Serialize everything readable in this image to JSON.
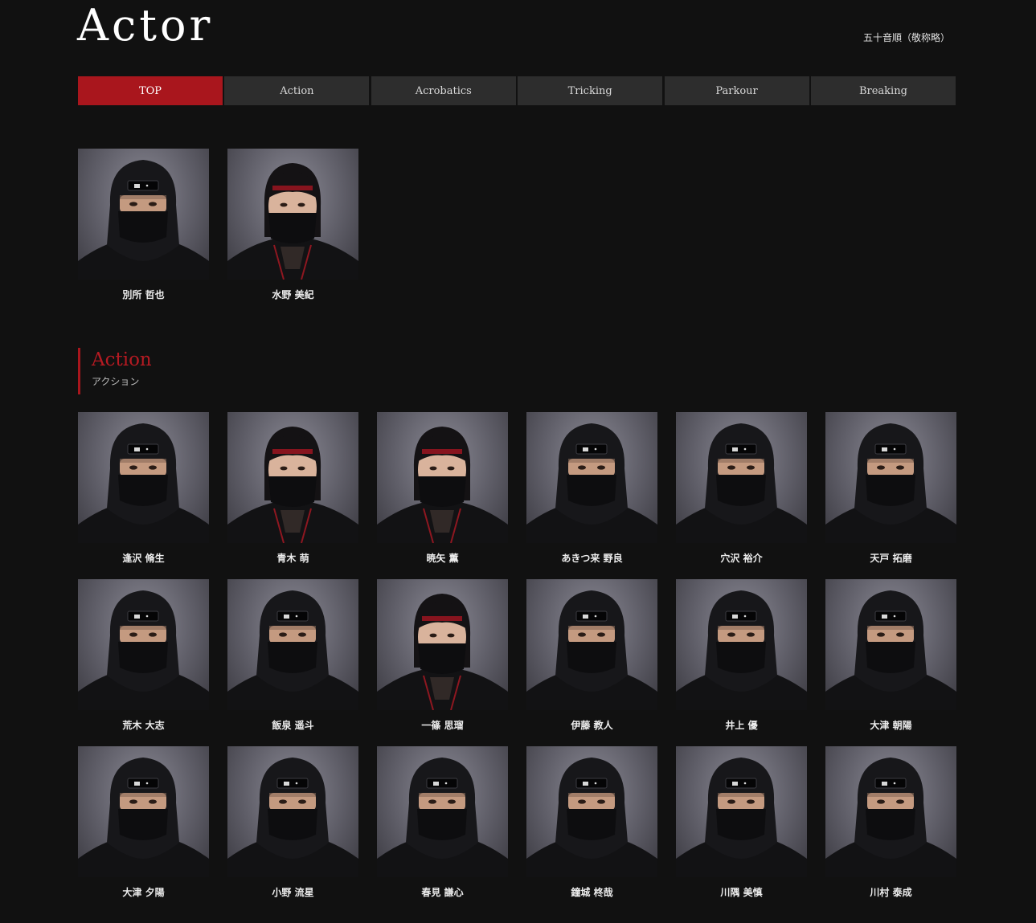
{
  "page": {
    "title": "Actor",
    "sort_note": "五十音順（敬称略）"
  },
  "tabs": [
    {
      "label": "TOP",
      "active": true
    },
    {
      "label": "Action",
      "active": false
    },
    {
      "label": "Acrobatics",
      "active": false
    },
    {
      "label": "Tricking",
      "active": false
    },
    {
      "label": "Parkour",
      "active": false
    },
    {
      "label": "Breaking",
      "active": false
    }
  ],
  "top_actors": [
    {
      "name": "別所 哲也",
      "style": "hood"
    },
    {
      "name": "水野 美紀",
      "style": "hair"
    }
  ],
  "action_section": {
    "title": "Action",
    "subtitle": "アクション",
    "actors": [
      {
        "name": "逢沢 脩生",
        "style": "hood"
      },
      {
        "name": "青木 萌",
        "style": "hair"
      },
      {
        "name": "暁矢 薫",
        "style": "hair"
      },
      {
        "name": "あきつ来 野良",
        "style": "hood"
      },
      {
        "name": "穴沢 裕介",
        "style": "hood"
      },
      {
        "name": "天戸 拓磨",
        "style": "hood"
      },
      {
        "name": "荒木 大志",
        "style": "hood"
      },
      {
        "name": "飯泉 遥斗",
        "style": "hood"
      },
      {
        "name": "一篠 思瑠",
        "style": "hair"
      },
      {
        "name": "伊藤 教人",
        "style": "hood"
      },
      {
        "name": "井上 優",
        "style": "hood"
      },
      {
        "name": "大津 朝陽",
        "style": "hood"
      },
      {
        "name": "大津 夕陽",
        "style": "hood"
      },
      {
        "name": "小野 流星",
        "style": "hood"
      },
      {
        "name": "春見 謙心",
        "style": "hood"
      },
      {
        "name": "鐘城 柊哉",
        "style": "hood"
      },
      {
        "name": "川隅 美慎",
        "style": "hood"
      },
      {
        "name": "川村 泰成",
        "style": "hood"
      }
    ]
  },
  "colors": {
    "background": "#111111",
    "accent": "#a9161d",
    "tab": "#2d2d2d"
  }
}
